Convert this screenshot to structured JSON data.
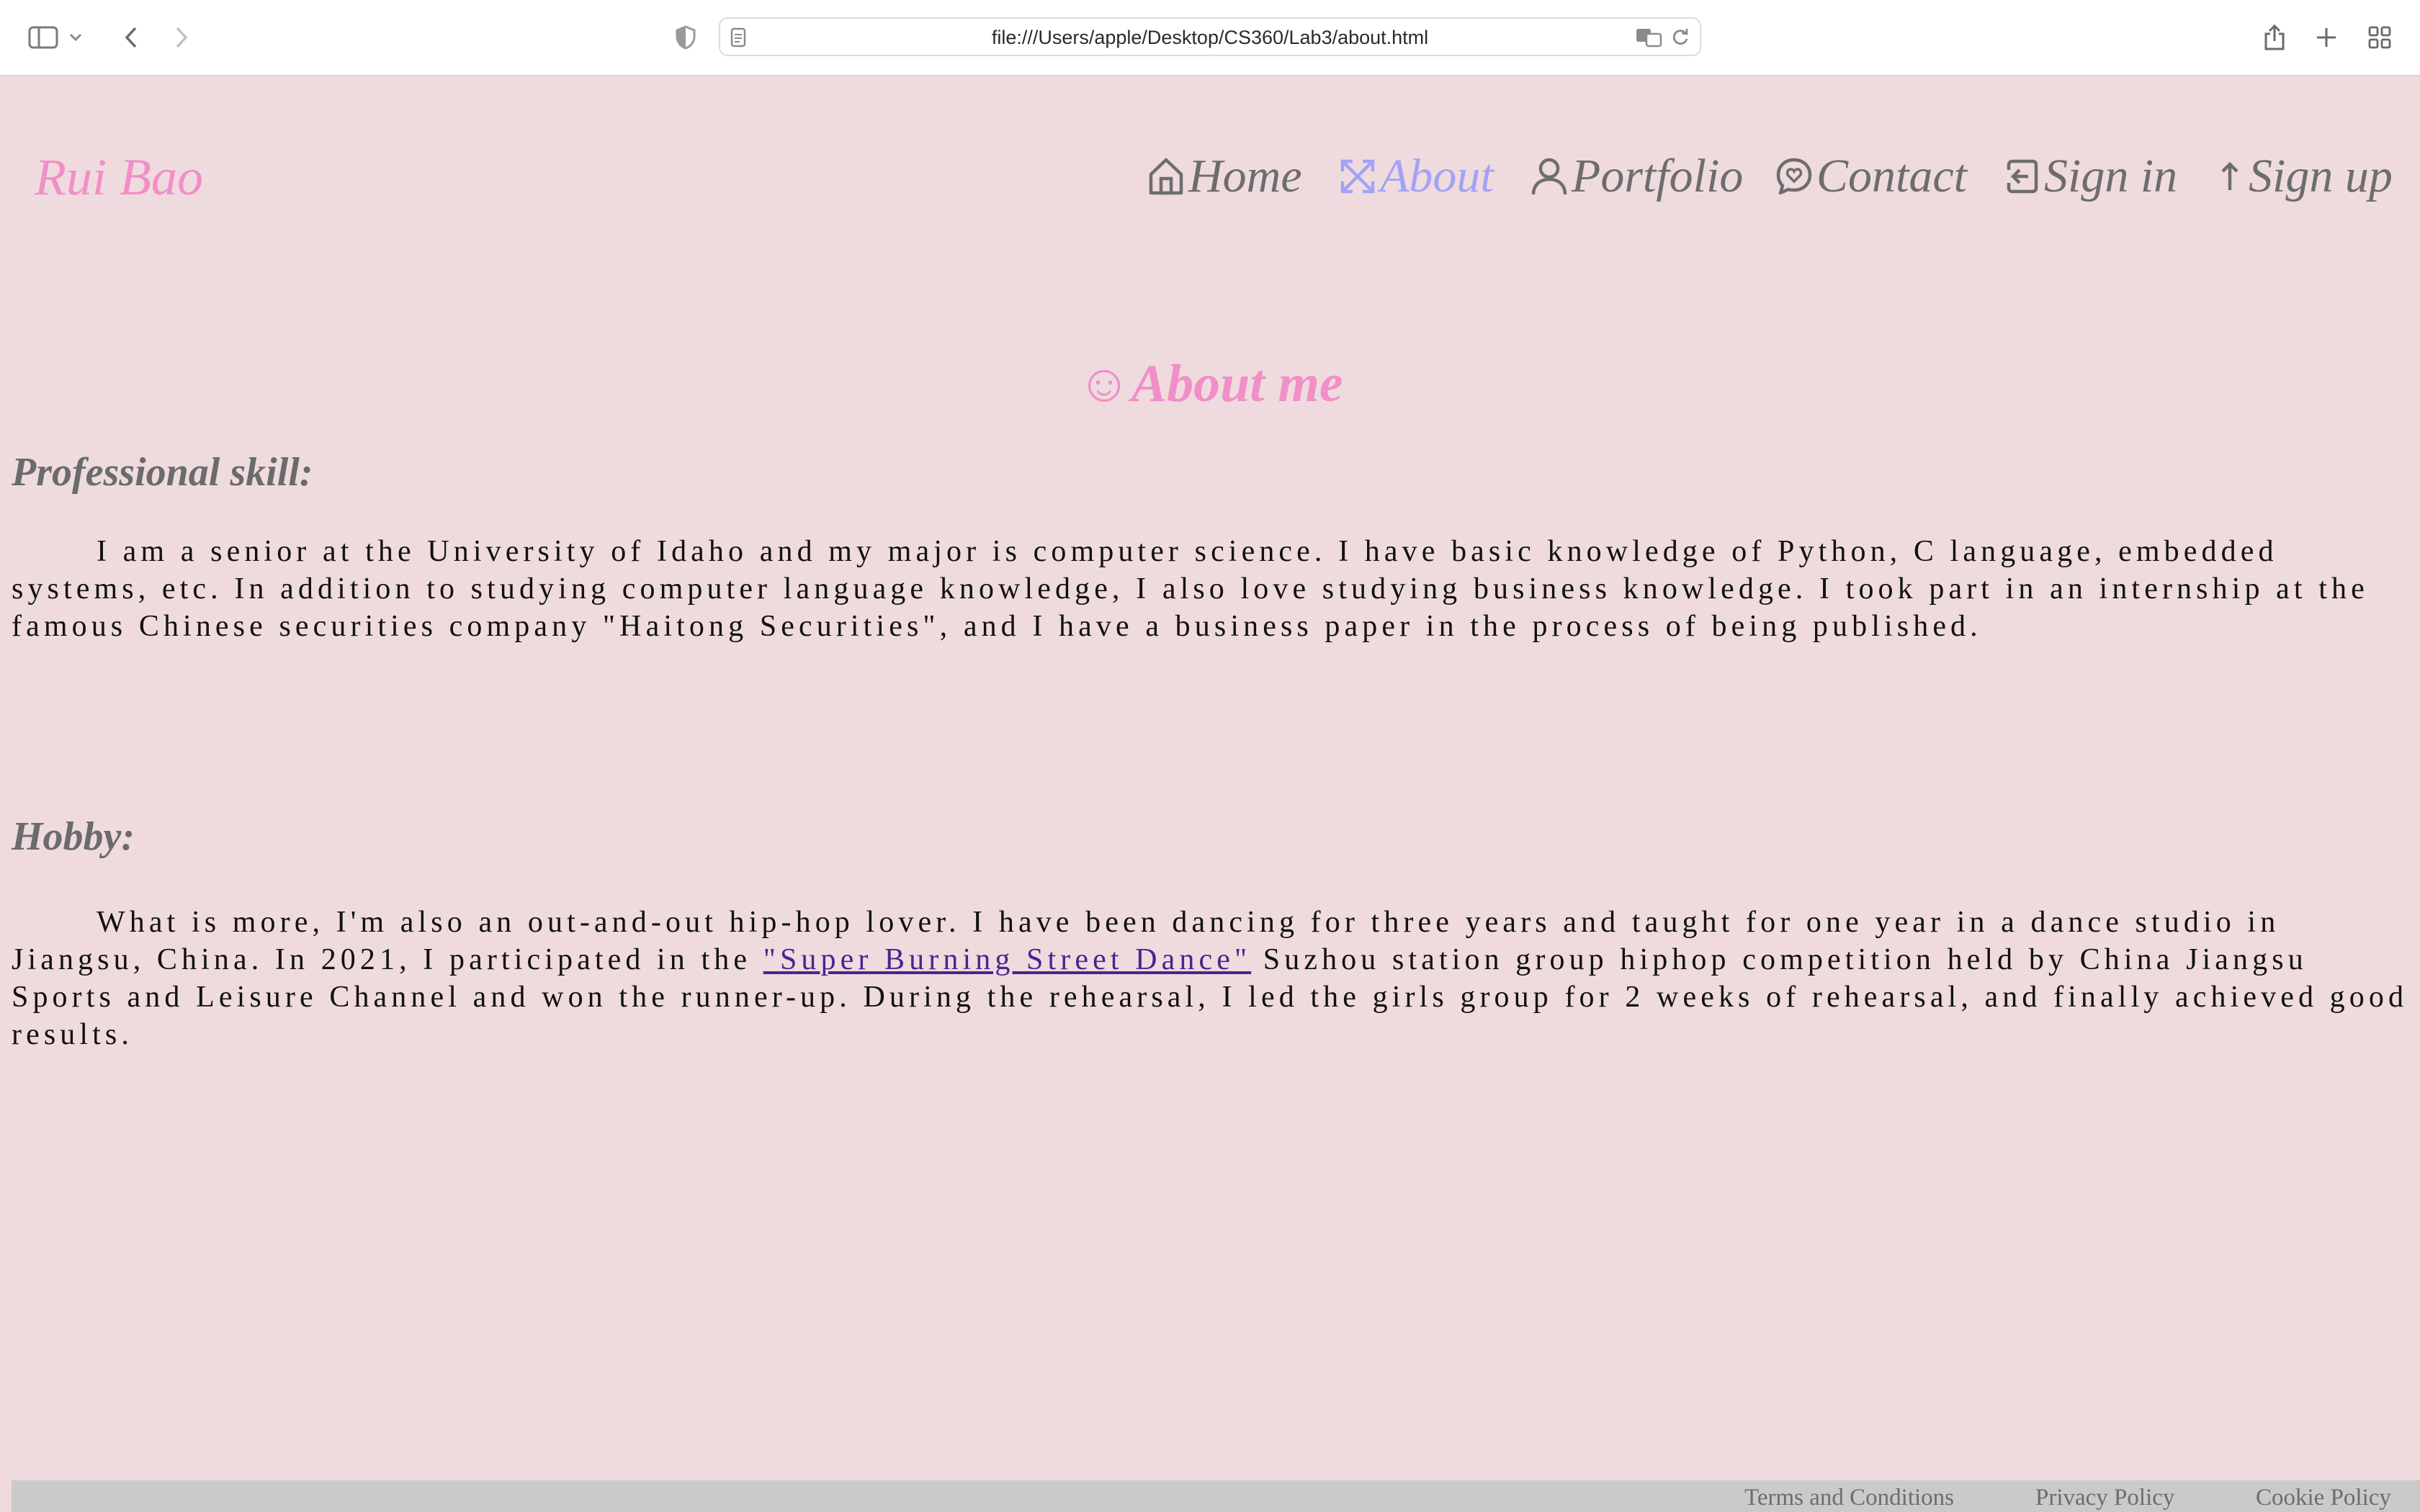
{
  "browser": {
    "url": "file:///Users/apple/Desktop/CS360/Lab3/about.html"
  },
  "header": {
    "brand": "Rui Bao",
    "nav": [
      {
        "label": "Home",
        "icon": "home-icon"
      },
      {
        "label": "About",
        "icon": "expand-arrows-icon",
        "active": true
      },
      {
        "label": "Portfolio",
        "icon": "person-icon"
      },
      {
        "label": "Contact",
        "icon": "chat-heart-icon"
      },
      {
        "label": "Sign in",
        "icon": "sign-in-icon"
      },
      {
        "label": "Sign up",
        "icon": "arrow-up-icon"
      }
    ]
  },
  "main": {
    "title_icon": "☺",
    "title": "About me",
    "skills_heading": "Professional skill:",
    "skills_text": "I am a senior at the University of Idaho and my major is computer science. I have basic knowledge of Python, C language, embedded systems, etc. In addition to studying computer language knowledge, I also love studying business knowledge. I took part in an internship at the famous Chinese securities company \"Haitong Securities\", and I have a business paper in the process of being published.",
    "hobby_heading": "Hobby:",
    "hobby_text_before": "What is more, I'm also an out-and-out hip-hop lover. I have been dancing for three years and taught for one year in a dance studio in Jiangsu, China. In 2021, I participated in the ",
    "hobby_link": "\"Super Burning Street Dance\"",
    "hobby_text_after": " Suzhou station group hiphop competition held by China Jiangsu Sports and Leisure Channel and won the runner-up. During the rehearsal, I led the girls group for 2 weeks of rehearsal, and finally achieved good results."
  },
  "footer": {
    "links": [
      "Terms and Conditions",
      "Privacy Policy",
      "Cookie Policy"
    ]
  },
  "colors": {
    "page_background": "#efdbde",
    "brand_pink": "#f08fc8",
    "nav_gray": "#6d6d6d",
    "nav_active": "#a3a3f5",
    "link_purple": "#4a2490",
    "footer_bg": "#cbc9c9"
  }
}
